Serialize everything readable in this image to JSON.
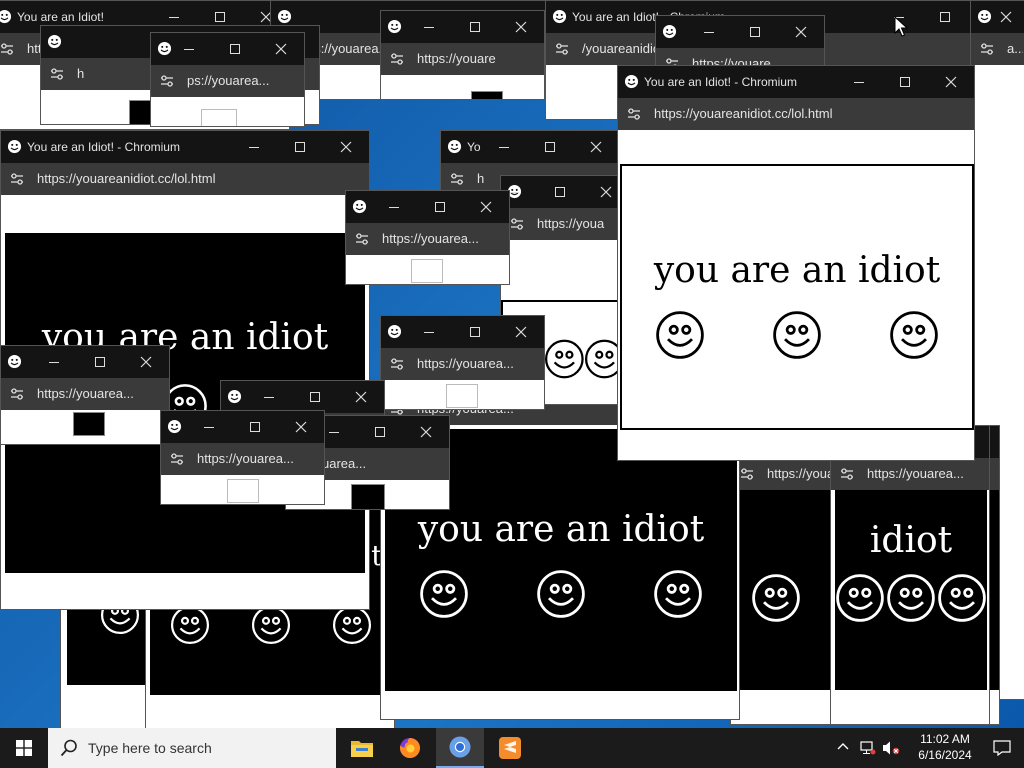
{
  "window_title": "You are an Idiot! - Chromium",
  "window_title_short": "You are an Idiot!",
  "url": "https://youareanidiot.cc/lol.html",
  "url_short": "https://youarea...",
  "url_tiny": "https://youare",
  "phrase": "you are an idiot",
  "phrase_fragment": "iot",
  "phrase_fragment_2": "idiot",
  "fragment_partial_title": "ou are an Idiot! - Chromium",
  "fragment_ya": "Yo",
  "fragment_url_partial": "/youareanidiot!",
  "fragment_ps": "ps://youarea...",
  "fragment_uarea": "uarea...",
  "fragment_youarea": "/youarea",
  "fragment_h": "h",
  "fragment_u": "u",
  "fragment_a": "a...",
  "fragment_tl": "l",
  "fragment_lt": "https://youa",
  "fragment_ht": "http",
  "fragment_to": "ttp",
  "fragment_idiot_title": "u are an Idiot! - Chromium",
  "taskbar": {
    "search_placeholder": "Type here to search",
    "apps": [
      "file-explorer",
      "firefox",
      "chromium",
      "sublime"
    ],
    "time": "11:02 AM",
    "date": "6/16/2024"
  },
  "icons": {
    "start": "windows-logo-icon",
    "search": "magnifier-icon",
    "tray_overflow": "chevron-up-icon",
    "network": "network-icon",
    "volume": "volume-muted-icon",
    "notifications": "notification-icon"
  }
}
